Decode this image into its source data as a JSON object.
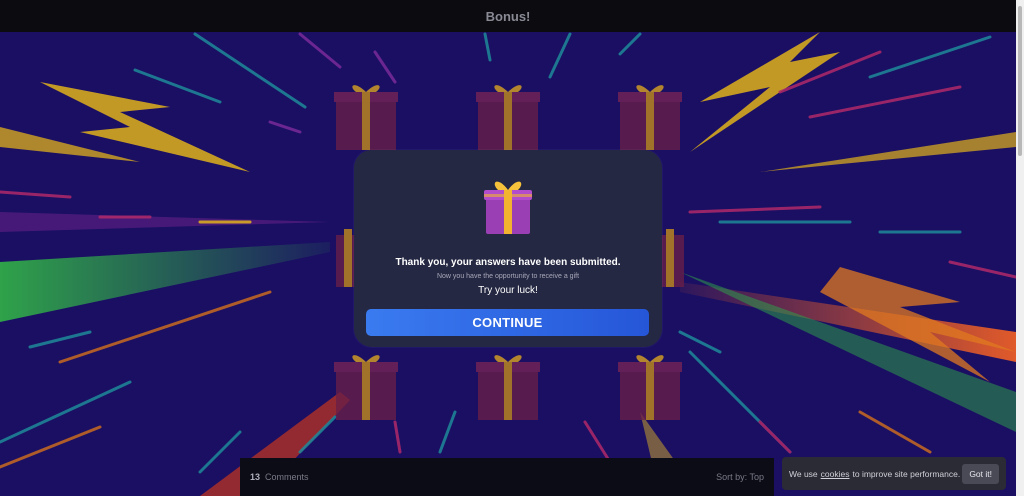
{
  "header": {
    "title": "Bonus!"
  },
  "modal": {
    "heading": "Thank you, your answers have been submitted.",
    "subtext": "Now you have the opportunity to receive a gift",
    "prompt": "Try your luck!",
    "button_label": "CONTINUE",
    "icon": "gift-icon"
  },
  "comments": {
    "count": "13",
    "label": "Comments",
    "sort_label": "Sort by: Top"
  },
  "cookie_banner": {
    "text_before": "We use",
    "link_label": "cookies",
    "text_after": "to improve site performance.",
    "button_label": "Got it!"
  },
  "colors": {
    "background": "#1a0f63",
    "modal": "#242842",
    "accent": "#3a7bf0",
    "gift": "#9b3fb5",
    "ribbon": "#f2b430"
  }
}
